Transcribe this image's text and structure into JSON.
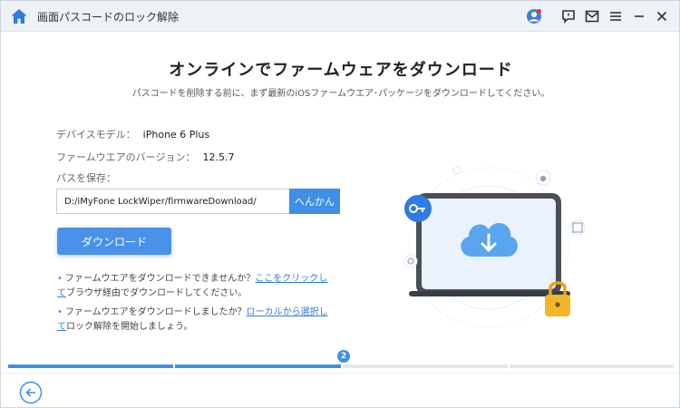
{
  "window": {
    "title": "画面パスコードのロック解除"
  },
  "header": {
    "title": "オンラインでファームウェアをダウンロード",
    "subtitle": "パスコードを削除する前に、まず最新のiOSファームウエア･パッケージをダウンロードしてください。"
  },
  "device": {
    "model_label": "デバイスモデル：",
    "model_value": "iPhone 6 Plus",
    "firmware_label": "ファームウエアのバージョン：",
    "firmware_value": "12.5.7",
    "save_path_label": "パスを保存："
  },
  "path_input": {
    "value": "D:/iMyFone LockWiper/firmwareDownload/"
  },
  "buttons": {
    "browse": "へんかん",
    "download": "ダウンロード"
  },
  "notes": [
    {
      "text": "ファームウエアをダウンロードできませんか？",
      "link": "ここをクリックして",
      "after": "ブラウザ経由でダウンロードしてください。"
    },
    {
      "text": "ファームウエアをダウンロードしましたか？",
      "link": "ローカルから選択して",
      "after": "ロック解除を開始しましょう。"
    }
  ],
  "progress": {
    "current_step": "2",
    "fraction": 0.5
  },
  "colors": {
    "accent": "#3f8fe6",
    "titlebar_bg": "#eef1f5",
    "link": "#2f7be0"
  },
  "icons": {
    "home": "home-icon",
    "avatar": "user-avatar-icon",
    "feedback": "feedback-icon",
    "mail": "mail-icon",
    "menu": "menu-icon",
    "minimize": "minimize-icon",
    "close": "close-icon",
    "back": "back-arrow-icon"
  }
}
